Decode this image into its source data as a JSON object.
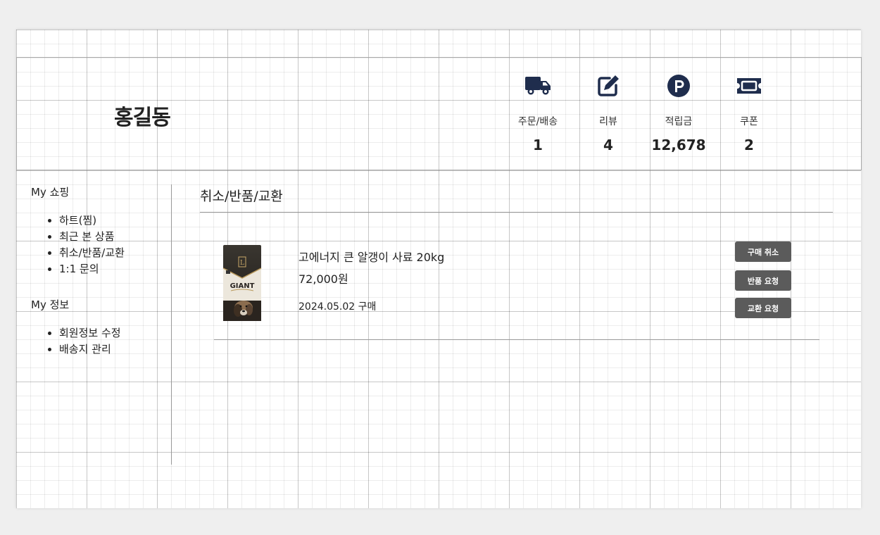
{
  "header": {
    "user_name": "홍길동",
    "stats": [
      {
        "label": "주문/배송",
        "value": "1",
        "icon": "truck-icon"
      },
      {
        "label": "리뷰",
        "value": "4",
        "icon": "edit-review-icon"
      },
      {
        "label": "적립금",
        "value": "12,678",
        "icon": "points-p-icon"
      },
      {
        "label": "쿠폰",
        "value": "2",
        "icon": "coupon-ticket-icon"
      }
    ],
    "icon_color": "#1f2d4d"
  },
  "sidebar": {
    "shopping_title": "My 쇼핑",
    "shopping_items": [
      "하트(찜)",
      "최근 본 상품",
      "취소/반품/교환",
      "1:1 문의"
    ],
    "info_title": "My 정보",
    "info_items": [
      "회원정보 수정",
      "배송지 관리"
    ]
  },
  "main": {
    "title": "취소/반품/교환",
    "order": {
      "product_name": "고에너지 큰 알갱이 사료 20kg",
      "price": "72,000원",
      "date": "2024.05.02 구매",
      "package_text": "GIANT",
      "package_badge": "L",
      "actions": [
        "구매 취소",
        "반품 요청",
        "교환 요청"
      ]
    }
  },
  "colors": {
    "button_bg": "#5b5b5b",
    "button_text": "#ffffff"
  }
}
